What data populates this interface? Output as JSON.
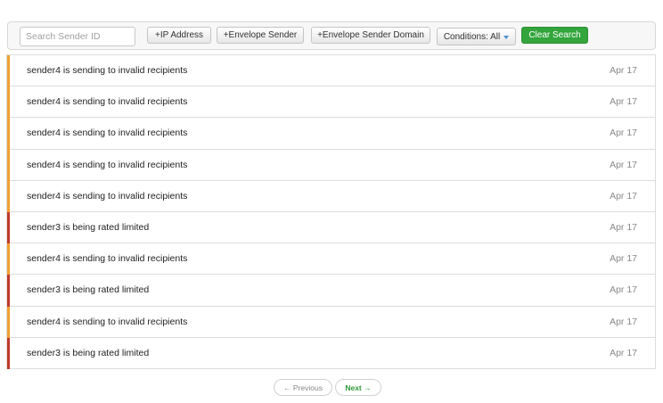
{
  "toolbar": {
    "search_placeholder": "Search Sender ID",
    "search_value": "",
    "ip_label": "+IP Address",
    "envelope_sender_label": "+Envelope Sender",
    "envelope_domain_label": "+Envelope Sender Domain",
    "conditions_label": "Conditions: All",
    "clear_label": "Clear Search"
  },
  "colors": {
    "warning": "#f0a030",
    "danger": "#c0392b",
    "accent_green": "#33a53c"
  },
  "alerts": [
    {
      "message": "sender4 is sending to invalid recipients",
      "date": "Apr 17",
      "level": "warning"
    },
    {
      "message": "sender4 is sending to invalid recipients",
      "date": "Apr 17",
      "level": "warning"
    },
    {
      "message": "sender4 is sending to invalid recipients",
      "date": "Apr 17",
      "level": "warning"
    },
    {
      "message": "sender4 is sending to invalid recipients",
      "date": "Apr 17",
      "level": "warning"
    },
    {
      "message": "sender4 is sending to invalid recipients",
      "date": "Apr 17",
      "level": "warning"
    },
    {
      "message": "sender3 is being rated limited",
      "date": "Apr 17",
      "level": "danger"
    },
    {
      "message": "sender4 is sending to invalid recipients",
      "date": "Apr 17",
      "level": "warning"
    },
    {
      "message": "sender3 is being rated limited",
      "date": "Apr 17",
      "level": "danger"
    },
    {
      "message": "sender4 is sending to invalid recipients",
      "date": "Apr 17",
      "level": "warning"
    },
    {
      "message": "sender3 is being rated limited",
      "date": "Apr 17",
      "level": "danger"
    }
  ],
  "pagination": {
    "previous_label": "← Previous",
    "next_label": "Next →"
  }
}
